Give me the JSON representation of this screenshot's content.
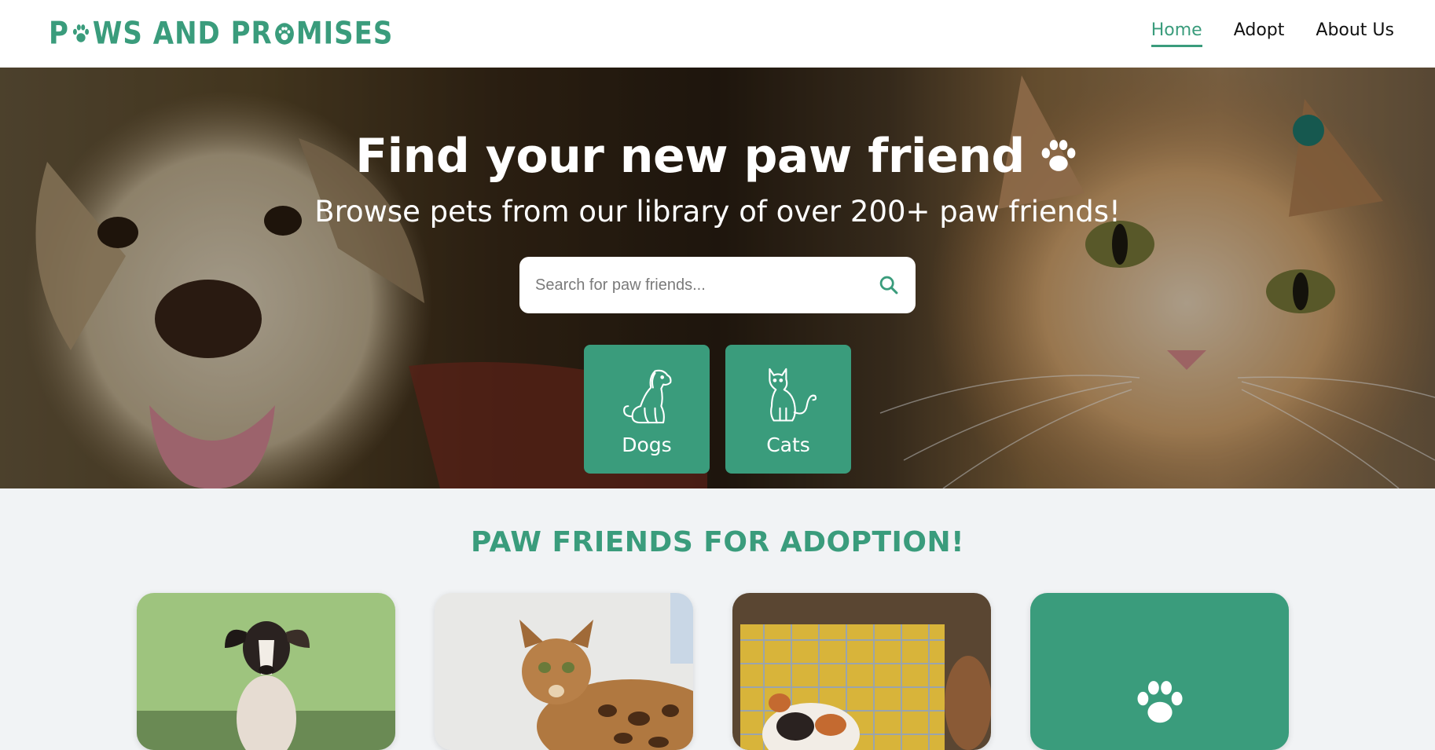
{
  "colors": {
    "accent": "#3a9c7c",
    "nav_bg": "#ffffff",
    "text": "#111111"
  },
  "nav": {
    "logo_text": "PAWS AND PROMISES",
    "links": [
      {
        "label": "Home",
        "active": true
      },
      {
        "label": "Adopt",
        "active": false
      },
      {
        "label": "About Us",
        "active": false
      }
    ]
  },
  "hero": {
    "title": "Find your new paw friend",
    "title_icon": "paw-icon",
    "subtitle": "Browse pets from our library of over 200+ paw friends!",
    "search": {
      "placeholder": "Search for paw friends...",
      "value": "",
      "icon": "search-icon"
    },
    "categories": [
      {
        "label": "Dogs",
        "icon": "dog-icon"
      },
      {
        "label": "Cats",
        "icon": "cat-icon"
      }
    ]
  },
  "adoption": {
    "title": "PAW FRIENDS FOR ADOPTION!",
    "cards": [
      {
        "image": "puppy-photo"
      },
      {
        "image": "bengal-cat-photo"
      },
      {
        "image": "calico-cat-photo"
      },
      {
        "icon": "paw-icon"
      }
    ]
  }
}
